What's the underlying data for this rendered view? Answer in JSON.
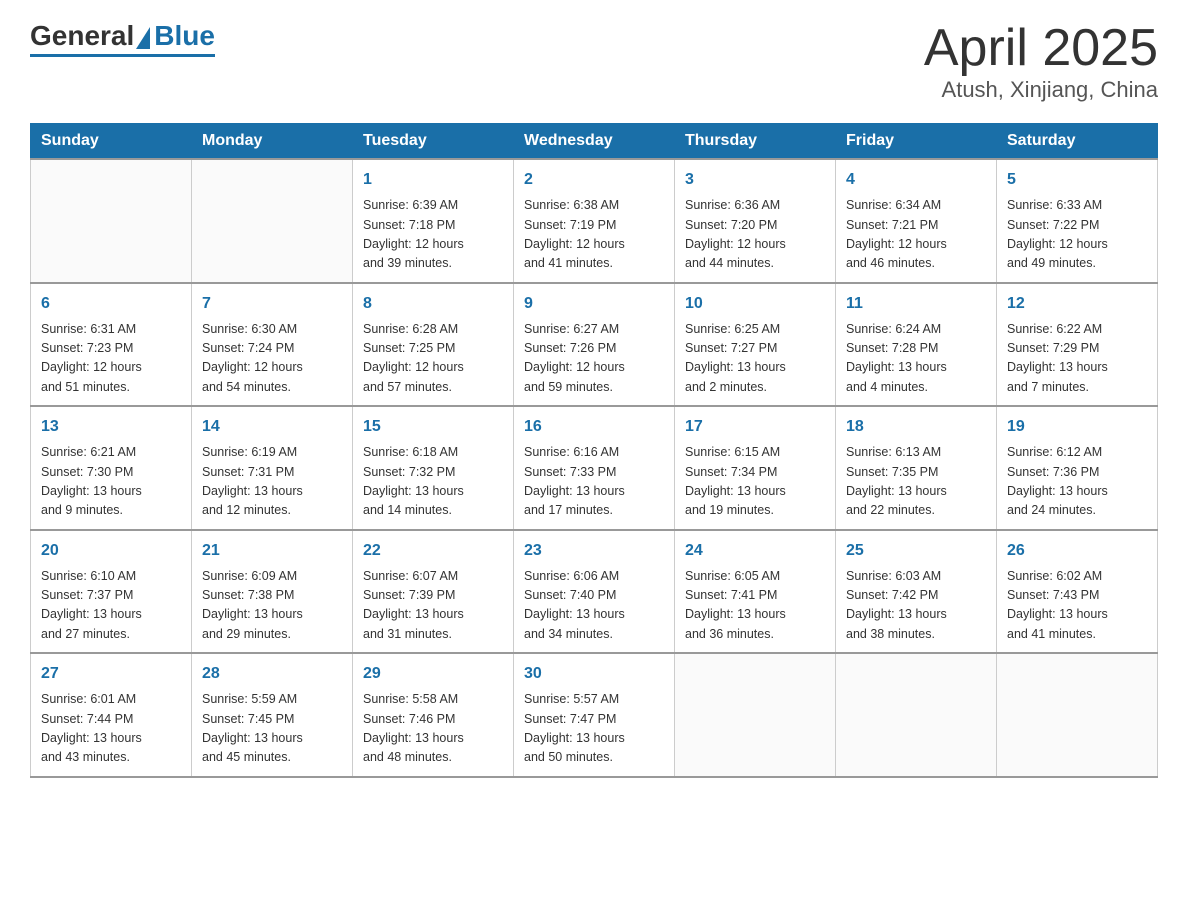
{
  "header": {
    "logo_general": "General",
    "logo_blue": "Blue",
    "month_title": "April 2025",
    "location": "Atush, Xinjiang, China"
  },
  "days_of_week": [
    "Sunday",
    "Monday",
    "Tuesday",
    "Wednesday",
    "Thursday",
    "Friday",
    "Saturday"
  ],
  "weeks": [
    [
      {
        "day": "",
        "info": ""
      },
      {
        "day": "",
        "info": ""
      },
      {
        "day": "1",
        "info": "Sunrise: 6:39 AM\nSunset: 7:18 PM\nDaylight: 12 hours\nand 39 minutes."
      },
      {
        "day": "2",
        "info": "Sunrise: 6:38 AM\nSunset: 7:19 PM\nDaylight: 12 hours\nand 41 minutes."
      },
      {
        "day": "3",
        "info": "Sunrise: 6:36 AM\nSunset: 7:20 PM\nDaylight: 12 hours\nand 44 minutes."
      },
      {
        "day": "4",
        "info": "Sunrise: 6:34 AM\nSunset: 7:21 PM\nDaylight: 12 hours\nand 46 minutes."
      },
      {
        "day": "5",
        "info": "Sunrise: 6:33 AM\nSunset: 7:22 PM\nDaylight: 12 hours\nand 49 minutes."
      }
    ],
    [
      {
        "day": "6",
        "info": "Sunrise: 6:31 AM\nSunset: 7:23 PM\nDaylight: 12 hours\nand 51 minutes."
      },
      {
        "day": "7",
        "info": "Sunrise: 6:30 AM\nSunset: 7:24 PM\nDaylight: 12 hours\nand 54 minutes."
      },
      {
        "day": "8",
        "info": "Sunrise: 6:28 AM\nSunset: 7:25 PM\nDaylight: 12 hours\nand 57 minutes."
      },
      {
        "day": "9",
        "info": "Sunrise: 6:27 AM\nSunset: 7:26 PM\nDaylight: 12 hours\nand 59 minutes."
      },
      {
        "day": "10",
        "info": "Sunrise: 6:25 AM\nSunset: 7:27 PM\nDaylight: 13 hours\nand 2 minutes."
      },
      {
        "day": "11",
        "info": "Sunrise: 6:24 AM\nSunset: 7:28 PM\nDaylight: 13 hours\nand 4 minutes."
      },
      {
        "day": "12",
        "info": "Sunrise: 6:22 AM\nSunset: 7:29 PM\nDaylight: 13 hours\nand 7 minutes."
      }
    ],
    [
      {
        "day": "13",
        "info": "Sunrise: 6:21 AM\nSunset: 7:30 PM\nDaylight: 13 hours\nand 9 minutes."
      },
      {
        "day": "14",
        "info": "Sunrise: 6:19 AM\nSunset: 7:31 PM\nDaylight: 13 hours\nand 12 minutes."
      },
      {
        "day": "15",
        "info": "Sunrise: 6:18 AM\nSunset: 7:32 PM\nDaylight: 13 hours\nand 14 minutes."
      },
      {
        "day": "16",
        "info": "Sunrise: 6:16 AM\nSunset: 7:33 PM\nDaylight: 13 hours\nand 17 minutes."
      },
      {
        "day": "17",
        "info": "Sunrise: 6:15 AM\nSunset: 7:34 PM\nDaylight: 13 hours\nand 19 minutes."
      },
      {
        "day": "18",
        "info": "Sunrise: 6:13 AM\nSunset: 7:35 PM\nDaylight: 13 hours\nand 22 minutes."
      },
      {
        "day": "19",
        "info": "Sunrise: 6:12 AM\nSunset: 7:36 PM\nDaylight: 13 hours\nand 24 minutes."
      }
    ],
    [
      {
        "day": "20",
        "info": "Sunrise: 6:10 AM\nSunset: 7:37 PM\nDaylight: 13 hours\nand 27 minutes."
      },
      {
        "day": "21",
        "info": "Sunrise: 6:09 AM\nSunset: 7:38 PM\nDaylight: 13 hours\nand 29 minutes."
      },
      {
        "day": "22",
        "info": "Sunrise: 6:07 AM\nSunset: 7:39 PM\nDaylight: 13 hours\nand 31 minutes."
      },
      {
        "day": "23",
        "info": "Sunrise: 6:06 AM\nSunset: 7:40 PM\nDaylight: 13 hours\nand 34 minutes."
      },
      {
        "day": "24",
        "info": "Sunrise: 6:05 AM\nSunset: 7:41 PM\nDaylight: 13 hours\nand 36 minutes."
      },
      {
        "day": "25",
        "info": "Sunrise: 6:03 AM\nSunset: 7:42 PM\nDaylight: 13 hours\nand 38 minutes."
      },
      {
        "day": "26",
        "info": "Sunrise: 6:02 AM\nSunset: 7:43 PM\nDaylight: 13 hours\nand 41 minutes."
      }
    ],
    [
      {
        "day": "27",
        "info": "Sunrise: 6:01 AM\nSunset: 7:44 PM\nDaylight: 13 hours\nand 43 minutes."
      },
      {
        "day": "28",
        "info": "Sunrise: 5:59 AM\nSunset: 7:45 PM\nDaylight: 13 hours\nand 45 minutes."
      },
      {
        "day": "29",
        "info": "Sunrise: 5:58 AM\nSunset: 7:46 PM\nDaylight: 13 hours\nand 48 minutes."
      },
      {
        "day": "30",
        "info": "Sunrise: 5:57 AM\nSunset: 7:47 PM\nDaylight: 13 hours\nand 50 minutes."
      },
      {
        "day": "",
        "info": ""
      },
      {
        "day": "",
        "info": ""
      },
      {
        "day": "",
        "info": ""
      }
    ]
  ],
  "colors": {
    "header_bg": "#1a6fa8",
    "link_blue": "#1a6fa8"
  }
}
